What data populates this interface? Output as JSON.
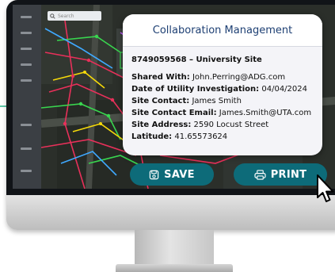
{
  "map": {
    "search_placeholder": "Search"
  },
  "panel": {
    "title": "Collaboration Management",
    "site_title": "8749059568 – University Site",
    "fields": [
      {
        "label": "Shared With:",
        "value": "John.Perring@ADG.com"
      },
      {
        "label": "Date of Utility Investigation:",
        "value": "04/04/2024"
      },
      {
        "label": "Site Contact:",
        "value": "James Smith"
      },
      {
        "label": "Site Contact Email:",
        "value": "James.Smith@UTA.com"
      },
      {
        "label": "Site Address:",
        "value": "2590 Locust Street"
      },
      {
        "label": "Latitude:",
        "value": "41.65573624"
      }
    ]
  },
  "actions": {
    "save_label": "SAVE",
    "print_label": "PRINT",
    "save_icon": "save-icon",
    "print_icon": "printer-icon"
  },
  "colors": {
    "accent": "#0d6b79",
    "title": "#1d3f73",
    "panel_bg": "#f4f4f8",
    "map_lines": [
      "#e8305a",
      "#39d64f",
      "#f5d90a",
      "#3fa9ff",
      "#c25cff"
    ]
  }
}
